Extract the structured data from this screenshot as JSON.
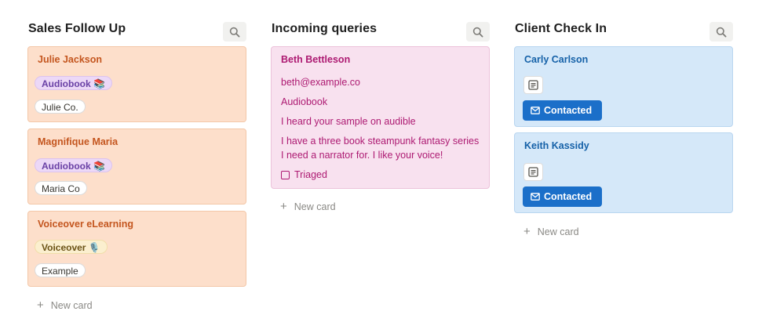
{
  "columns": [
    {
      "title": "Sales Follow Up",
      "cards": [
        {
          "title": "Julie Jackson",
          "tag": "Audiobook 📚",
          "company": "Julie Co."
        },
        {
          "title": "Magnifique Maria",
          "tag": "Audiobook 📚",
          "company": "Maria Co"
        },
        {
          "title": "Voiceover eLearning",
          "tag": "Voiceover 🎙️",
          "company": "Example"
        }
      ],
      "new_card": "New card"
    },
    {
      "title": "Incoming queries",
      "cards": [
        {
          "title": "Beth Bettleson",
          "email": "beth@example.co",
          "type": "Audiobook",
          "source": "I heard your sample on audible",
          "message": "I have a three book steampunk fantasy series I need a narrator for. I like your voice!",
          "checkbox_label": "Triaged",
          "checked": false
        }
      ],
      "new_card": "New card"
    },
    {
      "title": "Client Check In",
      "cards": [
        {
          "title": "Carly Carlson",
          "status": "Contacted"
        },
        {
          "title": "Keith Kassidy",
          "status": "Contacted"
        }
      ],
      "new_card": "New card"
    }
  ],
  "icons": {
    "search": "search-icon",
    "document": "document-icon",
    "mail": "mail-icon",
    "plus": "plus-icon"
  },
  "colors": {
    "orange_card": "#fddfcb",
    "pink_card": "#f8e1ef",
    "blue_card": "#d5e8f9",
    "contacted_button": "#1b6fc9"
  }
}
